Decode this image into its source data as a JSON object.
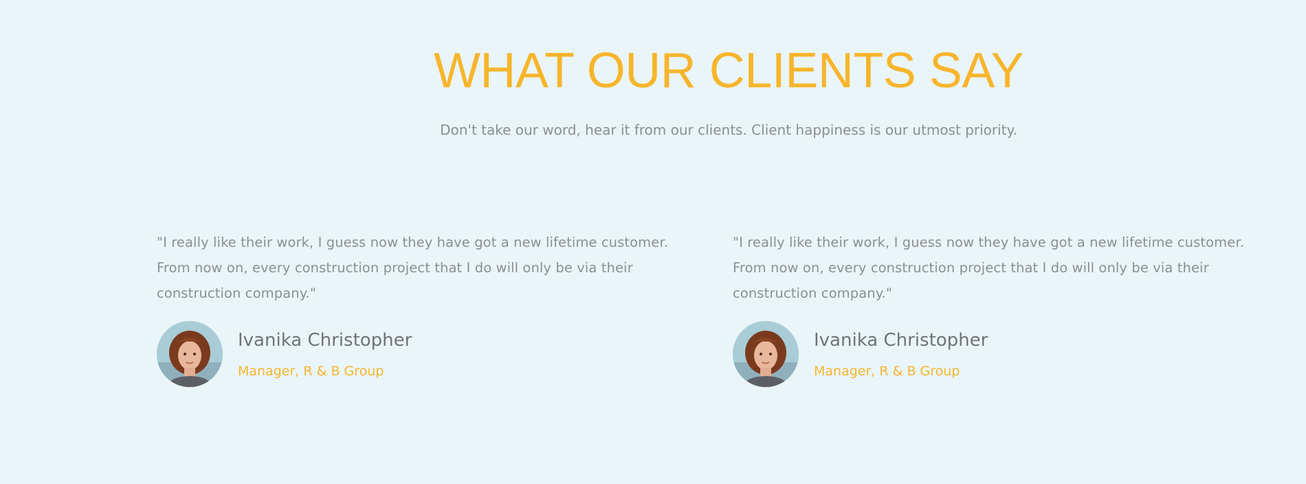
{
  "colors": {
    "background": "#eaf5f9",
    "accent": "#f7b52c",
    "body_text": "#8a8f93",
    "name_text": "#6f7478"
  },
  "section": {
    "title": "WHAT OUR CLIENTS SAY",
    "subtitle": "Don't take our word, hear it from our clients. Client happiness is our utmost priority."
  },
  "testimonials": [
    {
      "quote_line1": "\"I really like their work, I guess now they have got a new lifetime customer.",
      "quote_line2": "From now on, every construction project that I do will only be via their",
      "quote_line3": "construction company.\"",
      "name": "Ivanika Christopher",
      "role": "Manager, R & B Group",
      "avatar_icon": "portrait-avatar"
    },
    {
      "quote_line1": "\"I really like their work, I guess now they have got a new lifetime customer.",
      "quote_line2": "From now on, every construction project that I do will only be via their",
      "quote_line3": "construction company.\"",
      "name": "Ivanika Christopher",
      "role": "Manager, R & B Group",
      "avatar_icon": "portrait-avatar"
    }
  ]
}
